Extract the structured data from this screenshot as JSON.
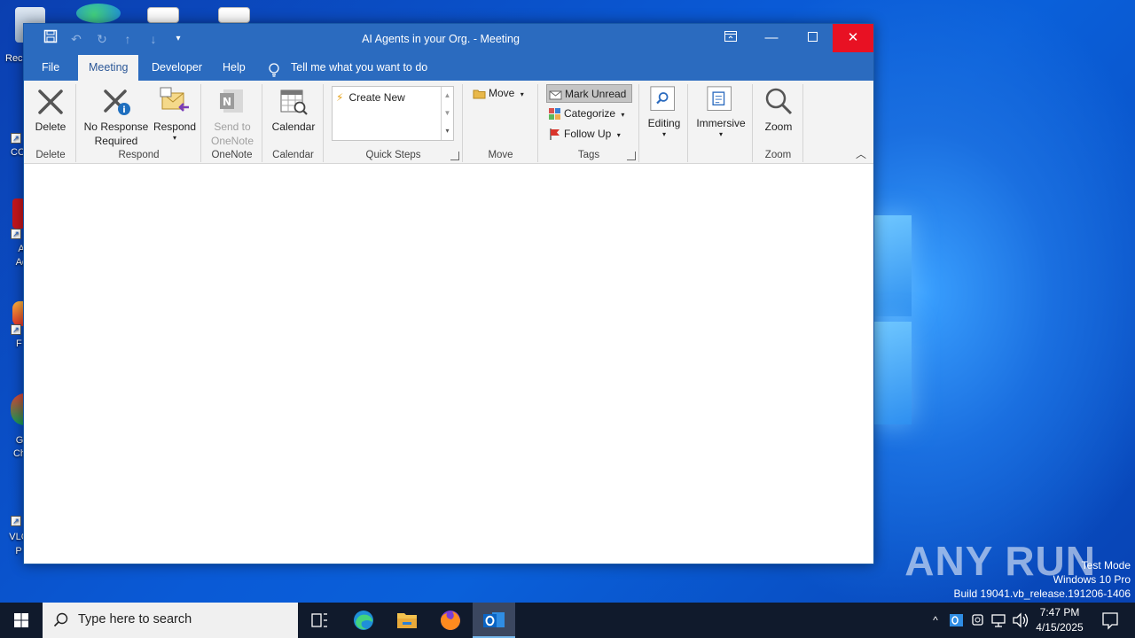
{
  "desktop": {
    "icons": [
      {
        "label": "Rec"
      },
      {
        "label": "CC"
      },
      {
        "label": "A Ac"
      },
      {
        "label": "F"
      },
      {
        "label": "G Ch"
      },
      {
        "label": "VLC P"
      }
    ],
    "watermark": "ANY RUN",
    "test_mode": {
      "line1": "Test Mode",
      "line2": "Windows 10 Pro",
      "line3": "Build 19041.vb_release.191206-1406"
    }
  },
  "window": {
    "title": "AI Agents in your Org.  -  Meeting",
    "tabs": [
      {
        "label": "File"
      },
      {
        "label": "Meeting"
      },
      {
        "label": "Developer"
      },
      {
        "label": "Help"
      }
    ],
    "tell_me": "Tell me what you want to do",
    "ribbon": {
      "delete_group": {
        "label": "Delete",
        "delete_btn": "Delete"
      },
      "respond_group": {
        "label": "Respond",
        "no_response_line1": "No Response",
        "no_response_line2": "Required",
        "respond_btn": "Respond"
      },
      "onenote_group": {
        "label": "OneNote",
        "send_line1": "Send to",
        "send_line2": "OneNote"
      },
      "calendar_group": {
        "label": "Calendar",
        "calendar_btn": "Calendar"
      },
      "quicksteps_group": {
        "label": "Quick Steps",
        "create_new": "Create New"
      },
      "move_group": {
        "label": "Move",
        "move_btn": "Move"
      },
      "tags_group": {
        "label": "Tags",
        "mark_unread": "Mark Unread",
        "categorize": "Categorize",
        "follow_up": "Follow Up"
      },
      "editing_group": {
        "editing_btn": "Editing"
      },
      "immersive_group": {
        "immersive_btn": "Immersive"
      },
      "zoom_group": {
        "label": "Zoom",
        "zoom_btn": "Zoom"
      }
    }
  },
  "taskbar": {
    "search_placeholder": "Type here to search",
    "clock_time": "7:47 PM",
    "clock_date": "4/15/2025"
  },
  "colors": {
    "titlebar": "#2b6bbf",
    "close_red": "#e81123",
    "ribbon_bg": "#f3f3f3",
    "taskbar": "#101a2c"
  }
}
